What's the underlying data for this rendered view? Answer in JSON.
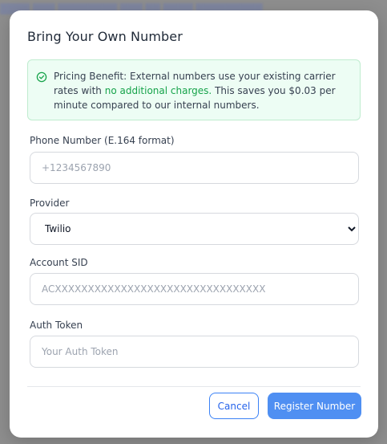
{
  "modal": {
    "title": "Bring Your Own Number"
  },
  "notice": {
    "icon": "check-circle-icon",
    "color": "#16a34a",
    "prefix": "Pricing Benefit: External numbers use your existing carrier rates with ",
    "highlight": "no additional charges.",
    "suffix": " This saves you $0.03 per minute compared to our internal numbers."
  },
  "form": {
    "phone": {
      "label": "Phone Number (E.164 format)",
      "placeholder": "+1234567890",
      "value": ""
    },
    "provider": {
      "label": "Provider",
      "selected": "Twilio"
    },
    "account_sid": {
      "label": "Account SID",
      "placeholder": "ACXXXXXXXXXXXXXXXXXXXXXXXXXXXXXXXX",
      "value": ""
    },
    "auth_token": {
      "label": "Auth Token",
      "placeholder": "Your Auth Token",
      "value": ""
    }
  },
  "actions": {
    "cancel_label": "Cancel",
    "register_label": "Register Number",
    "primary_color": "#4f8ff2"
  }
}
